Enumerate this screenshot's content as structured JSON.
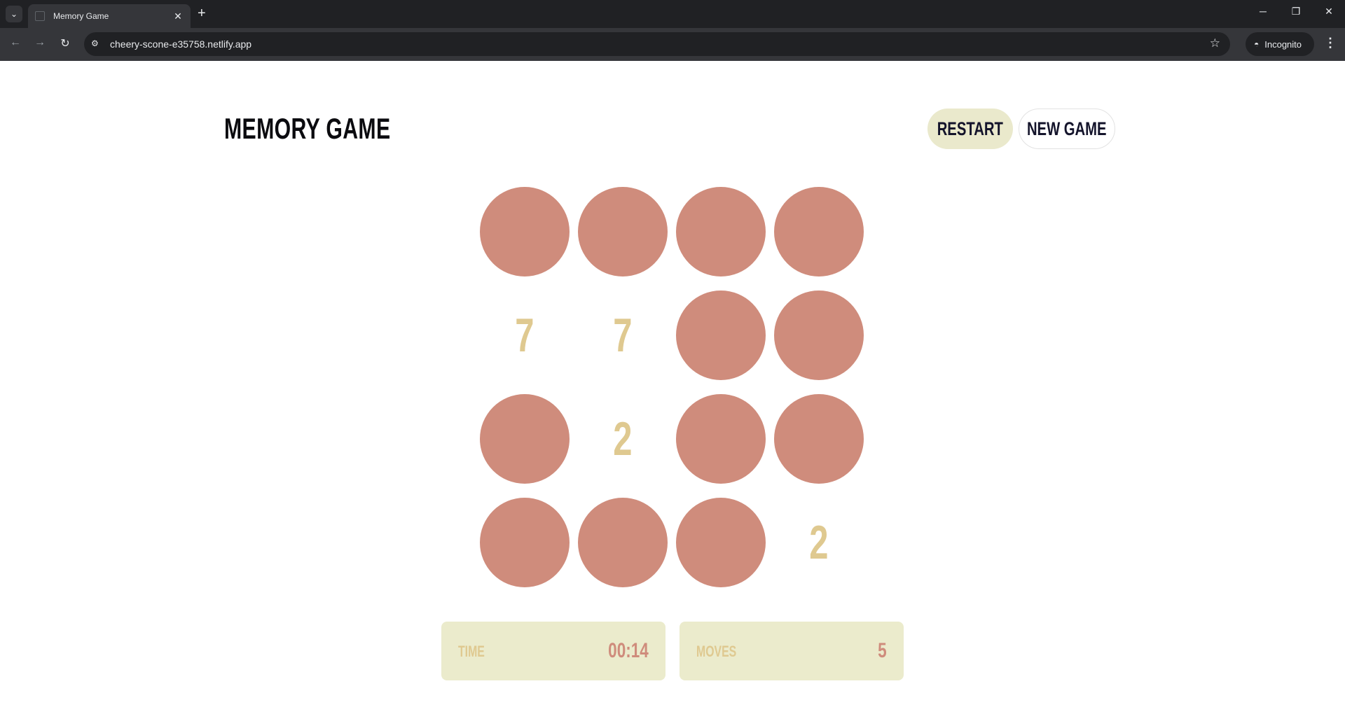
{
  "browser": {
    "tab_title": "Memory Game",
    "url": "cheery-scone-e35758.netlify.app",
    "incognito_label": "Incognito"
  },
  "game": {
    "title": "MEMORY GAME",
    "restart_label": "RESTART",
    "new_game_label": "NEW GAME",
    "board": [
      [
        "",
        "",
        "",
        ""
      ],
      [
        "7",
        "7",
        "",
        ""
      ],
      [
        "",
        "2",
        "",
        ""
      ],
      [
        "",
        "",
        "",
        "2"
      ]
    ],
    "time_label": "TIME",
    "time_value": "00:14",
    "moves_label": "MOVES",
    "moves_value": "5",
    "colors": {
      "hidden_tile": "#cf8c7c",
      "revealed_number": "#dfc990",
      "stat_background": "#ebebcc",
      "restart_background": "#eae9cc"
    }
  }
}
